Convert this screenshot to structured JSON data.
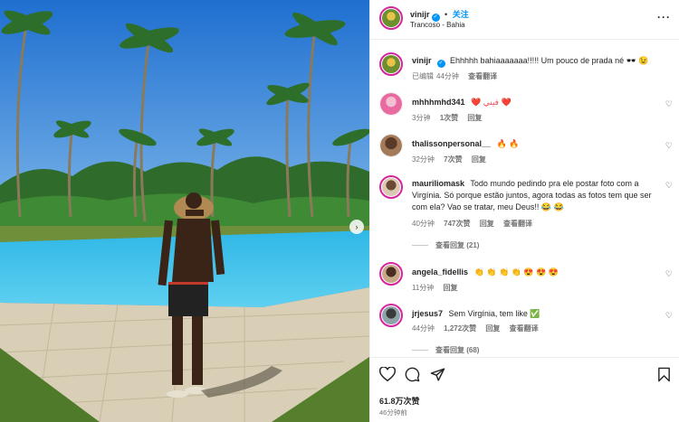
{
  "header": {
    "username": "vinijr",
    "follow_label": "关注",
    "location": "Trancoso - Bahia",
    "more_label": "···"
  },
  "caption": {
    "username": "vinijr",
    "text": "Ehhhhh bahiaaaaaaa!!!!! Um pouco de prada né 🕶️ 😉",
    "edited": "已编辑",
    "time": "44分钟",
    "translate": "查看翻译"
  },
  "comments": [
    {
      "username": "mhhhmhd341",
      "text": "❤️ فيني ❤️",
      "time": "3分钟",
      "likes": "1次赞",
      "reply": "回复"
    },
    {
      "username": "thalissonpersonal__",
      "text": "🔥 🔥",
      "time": "32分钟",
      "likes": "7次赞",
      "reply": "回复"
    },
    {
      "username": "mauriliomask",
      "text": "Todo mundo pedindo pra ele postar foto com a Virgínia. Só porque estão juntos, agora todas as fotos tem que ser com ela? Vao se tratar, meu Deus!! 😂 😂",
      "time": "40分钟",
      "likes": "747次赞",
      "reply": "回复",
      "translate": "查看翻译",
      "replies": "查看回复 (21)"
    },
    {
      "username": "angela_fidellis",
      "text": "👏 👏 👏 👏 😍 😍 😍",
      "time": "11分钟",
      "reply": "回复"
    },
    {
      "username": "jrjesus7",
      "text": "Sem Virgínia, tem like ✅",
      "time": "44分钟",
      "likes": "1,272次赞",
      "reply": "回复",
      "translate": "查看翻译",
      "replies": "查看回复 (68)"
    }
  ],
  "footer": {
    "likes": "61.8万次赞",
    "time_ago": "46分钟前"
  },
  "icons": {
    "verified": "✓",
    "heart": "♡",
    "next": "›"
  },
  "colors": {
    "accent": "#0095f6",
    "ring": "#d6249f",
    "secondary_text": "#737373"
  }
}
